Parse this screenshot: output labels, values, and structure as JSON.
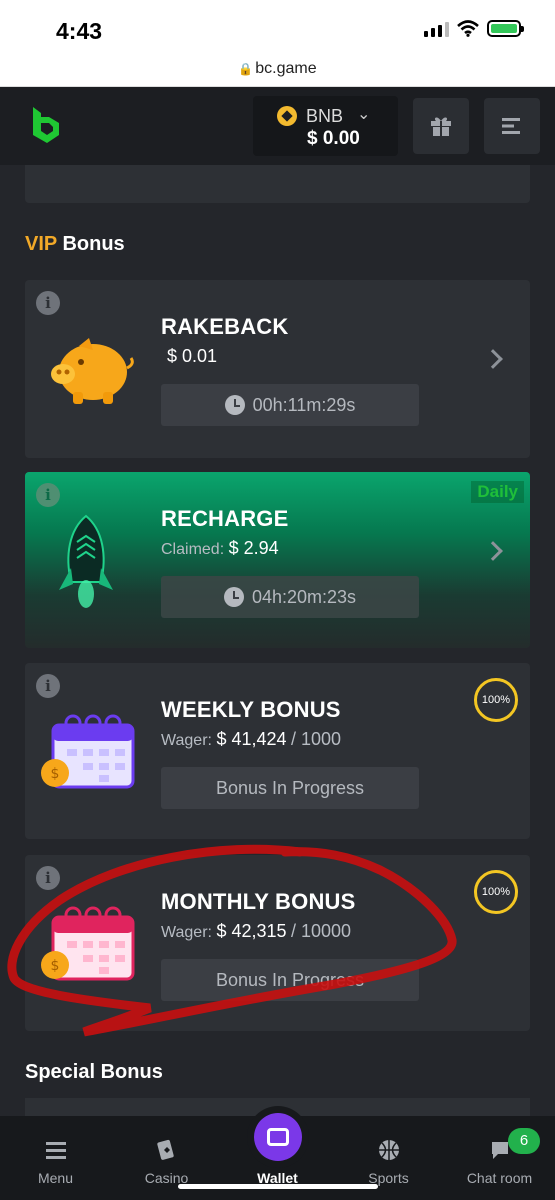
{
  "status_bar": {
    "time": "4:43"
  },
  "browser": {
    "url": "bc.game"
  },
  "header": {
    "currency": "BNB",
    "balance": "$ 0.00",
    "icons": [
      "bc-logo-icon",
      "chevron-down-icon",
      "gift-icon",
      "menu-icon"
    ]
  },
  "vip_section": {
    "title_accent": "VIP",
    "title_rest": "Bonus"
  },
  "cards": [
    {
      "title": "RAKEBACK",
      "amount": "$ 0.01",
      "timer": "00h:11m:29s"
    },
    {
      "title": "RECHARGE",
      "sub_label": "Claimed:",
      "amount": "$ 2.94",
      "timer": "04h:20m:23s",
      "badge": "Daily"
    },
    {
      "title": "WEEKLY BONUS",
      "sub_label": "Wager:",
      "amount": "$ 41,424",
      "target": "/ 1000",
      "progress": "100%",
      "progress_value": 100,
      "status": "Bonus In Progress"
    },
    {
      "title": "MONTHLY BONUS",
      "sub_label": "Wager:",
      "amount": "$ 42,315",
      "target": "/ 10000",
      "progress": "100%",
      "progress_value": 100,
      "status": "Bonus In Progress"
    }
  ],
  "special_section": {
    "title": "Special Bonus"
  },
  "nav": {
    "items": [
      {
        "label": "Menu",
        "icon": "hamburger-icon"
      },
      {
        "label": "Casino",
        "icon": "casino-icon"
      },
      {
        "label": "Wallet",
        "icon": "wallet-icon"
      },
      {
        "label": "Sports",
        "icon": "basketball-icon"
      },
      {
        "label": "Chat room",
        "icon": "chat-icon"
      }
    ],
    "chat_badge": "6"
  },
  "colors": {
    "accent": "#f2a928",
    "recharge_green": "#0aa56d",
    "wallet_purple": "#7b38e8",
    "progress_yellow": "#f3c623"
  }
}
